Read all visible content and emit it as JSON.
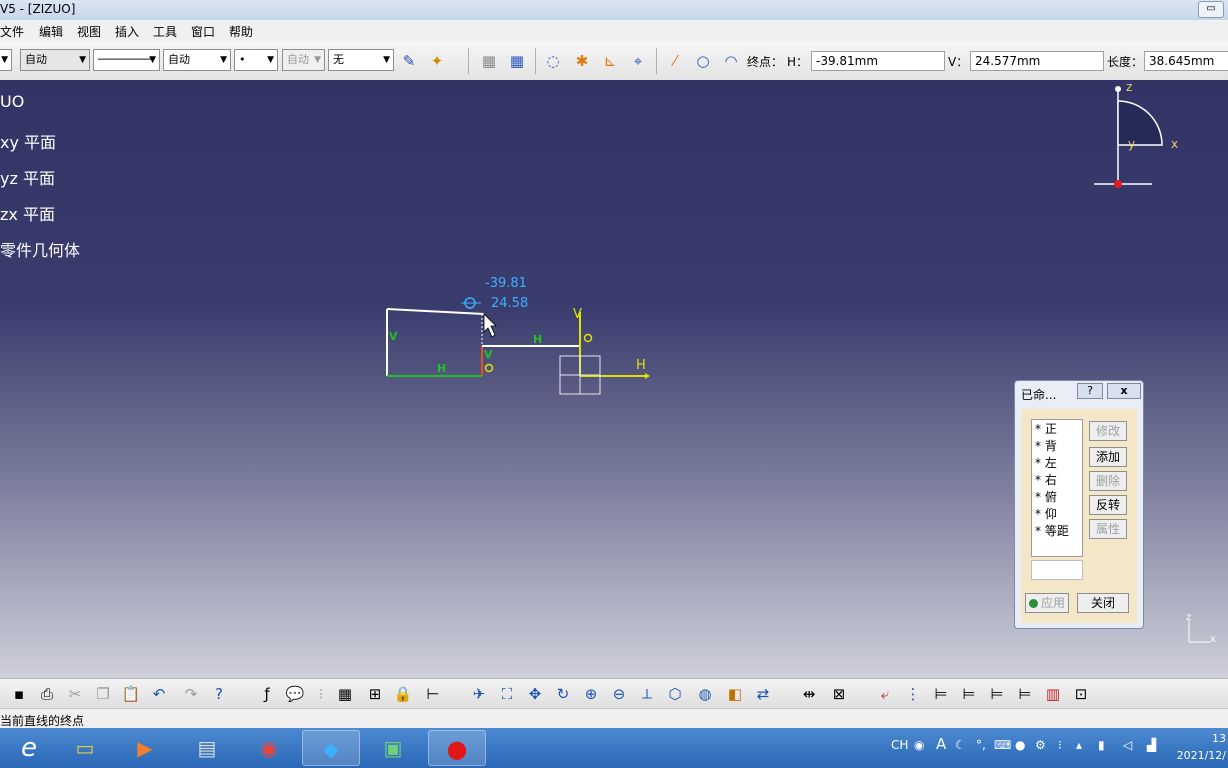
{
  "window": {
    "title": "V5 - [ZIZUO]",
    "restore": "▭"
  },
  "menu": [
    "文件",
    "编辑",
    "视图",
    "插入",
    "工具",
    "窗口",
    "帮助"
  ],
  "toolbar": {
    "color_combo": "自动",
    "linetype_combo": "────────",
    "thickness_combo": "自动",
    "point_combo": "•",
    "layer_combo": "自动",
    "pattern_combo": "无",
    "endpoint_label": "终点：",
    "h_label": "H：",
    "h_value": "-39.81mm",
    "v_label": "V：",
    "v_value": "24.577mm",
    "length_label": "长度：",
    "length_value": "38.645mm"
  },
  "tree": [
    "UO",
    "xy 平面",
    "yz 平面",
    "zx 平面",
    "零件几何体"
  ],
  "sketch": {
    "dim_h": "-39.81",
    "dim_v": "24.58",
    "label_v": "V",
    "label_h": "H",
    "constraint_v": "V",
    "constraint_h": "H",
    "axis_h": "H",
    "axis_v": "V",
    "compass_z": "z",
    "compass_x": "x",
    "compass_y": "y",
    "mini_z": "z",
    "mini_x": "x"
  },
  "dialog": {
    "title": "已命...",
    "help": "?",
    "close_x": "x",
    "views": [
      "* 正",
      "* 背",
      "* 左",
      "* 右",
      "* 俯",
      "* 仰",
      "* 等距"
    ],
    "btn_modify": "修改",
    "btn_add": "添加",
    "btn_delete": "删除",
    "btn_reverse": "反转",
    "btn_props": "属性",
    "btn_apply": "应用",
    "btn_close": "关闭"
  },
  "status": "当前直线的终点",
  "taskbar": {
    "ime": "CH",
    "time": "13",
    "date": "2021/12/"
  }
}
